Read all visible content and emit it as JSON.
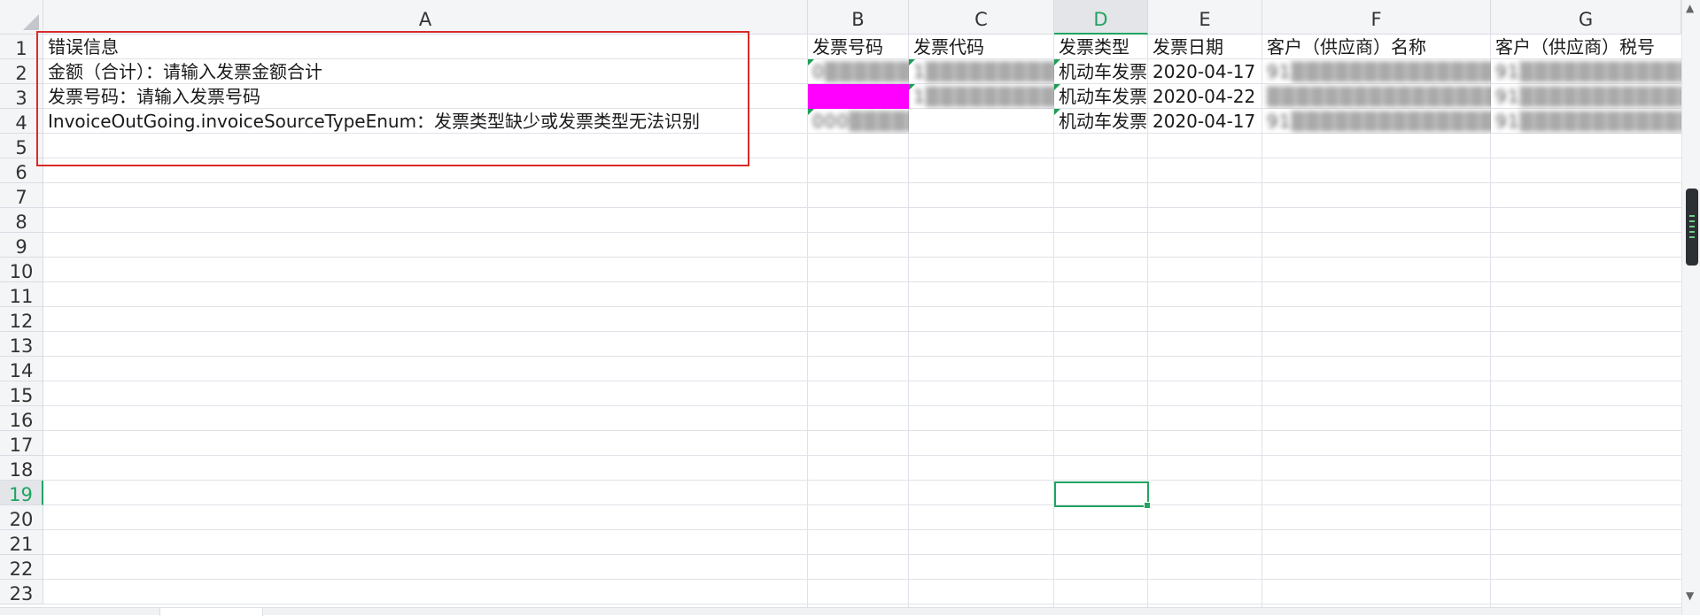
{
  "columns": [
    {
      "letter": "A",
      "active": false
    },
    {
      "letter": "B",
      "active": false
    },
    {
      "letter": "C",
      "active": false
    },
    {
      "letter": "D",
      "active": true
    },
    {
      "letter": "E",
      "active": false
    },
    {
      "letter": "F",
      "active": false
    },
    {
      "letter": "G",
      "active": false
    }
  ],
  "rows": [
    "1",
    "2",
    "3",
    "4",
    "5",
    "6",
    "7",
    "8",
    "9",
    "10",
    "11",
    "12",
    "13",
    "14",
    "15",
    "16",
    "17",
    "18",
    "19",
    "20",
    "21",
    "22",
    "23"
  ],
  "active_row": "19",
  "header_row": {
    "A": "错误信息",
    "B": "发票号码",
    "C": "发票代码",
    "D": "发票类型",
    "E": "发票日期",
    "F": "客户（供应商）名称",
    "G": "客户（供应商）税号"
  },
  "data_rows": [
    {
      "A": "金额（合计）：请输入发票金额合计",
      "B": "0▒▒▒▒▒▒▒▒",
      "C": "1▒▒▒▒▒▒▒▒▒▒▒1",
      "D": "机动车发票",
      "E": "2020-04-17",
      "F": "91▒▒▒▒▒▒▒▒▒▒▒▒▒▒▒W▒▒",
      "G": "91▒▒▒▒▒▒▒▒▒▒▒▒▒▒▒▒W▒▒"
    },
    {
      "A": "发票号码：请输入发票号码",
      "B": "",
      "C": "1▒▒▒▒▒▒▒▒▒▒.1",
      "D": "机动车发票",
      "E": "2020-04-22",
      "F": "▒▒▒▒▒▒▒▒▒▒▒▒▒▒▒▒▒▒▒",
      "G": "91▒▒▒▒▒▒▒▒▒▒▒▒▒▒▒▒▒▒▒"
    },
    {
      "A": "InvoiceOutGoing.invoiceSourceTypeEnum：发票类型缺少或发票类型无法识别",
      "B": "000▒▒▒▒▒",
      "C": "",
      "D": "机动车发票",
      "E": "2020-04-17",
      "F": "91▒▒▒▒▒▒▒▒▒▒▒▒▒▒▒▒▒▒",
      "G": "91▒▒▒▒▒▒▒▒▒▒▒▒▒▒▒▒▒▒▒"
    }
  ],
  "colors": {
    "accent": "#1fa461",
    "highlight_fill": "#ff00ff",
    "annotation_border": "#d92a2a"
  }
}
